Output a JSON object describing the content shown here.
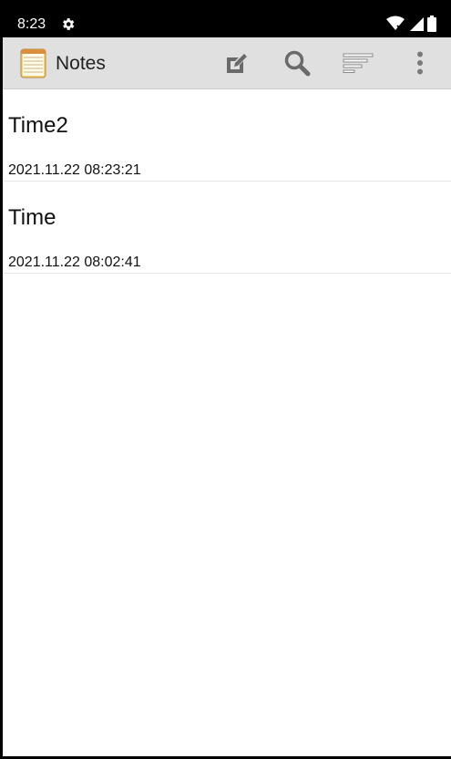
{
  "status_bar": {
    "time": "8:23",
    "icons": [
      "gear-icon",
      "wifi-icon",
      "signal-icon",
      "battery-icon"
    ]
  },
  "app": {
    "title": "Notes",
    "actions": [
      "edit-icon",
      "search-icon",
      "sort-icon",
      "more-vert-icon"
    ]
  },
  "notes": [
    {
      "title": "Time2",
      "date": "2021.11.22 08:23:21"
    },
    {
      "title": "Time",
      "date": "2021.11.22 08:02:41"
    }
  ]
}
